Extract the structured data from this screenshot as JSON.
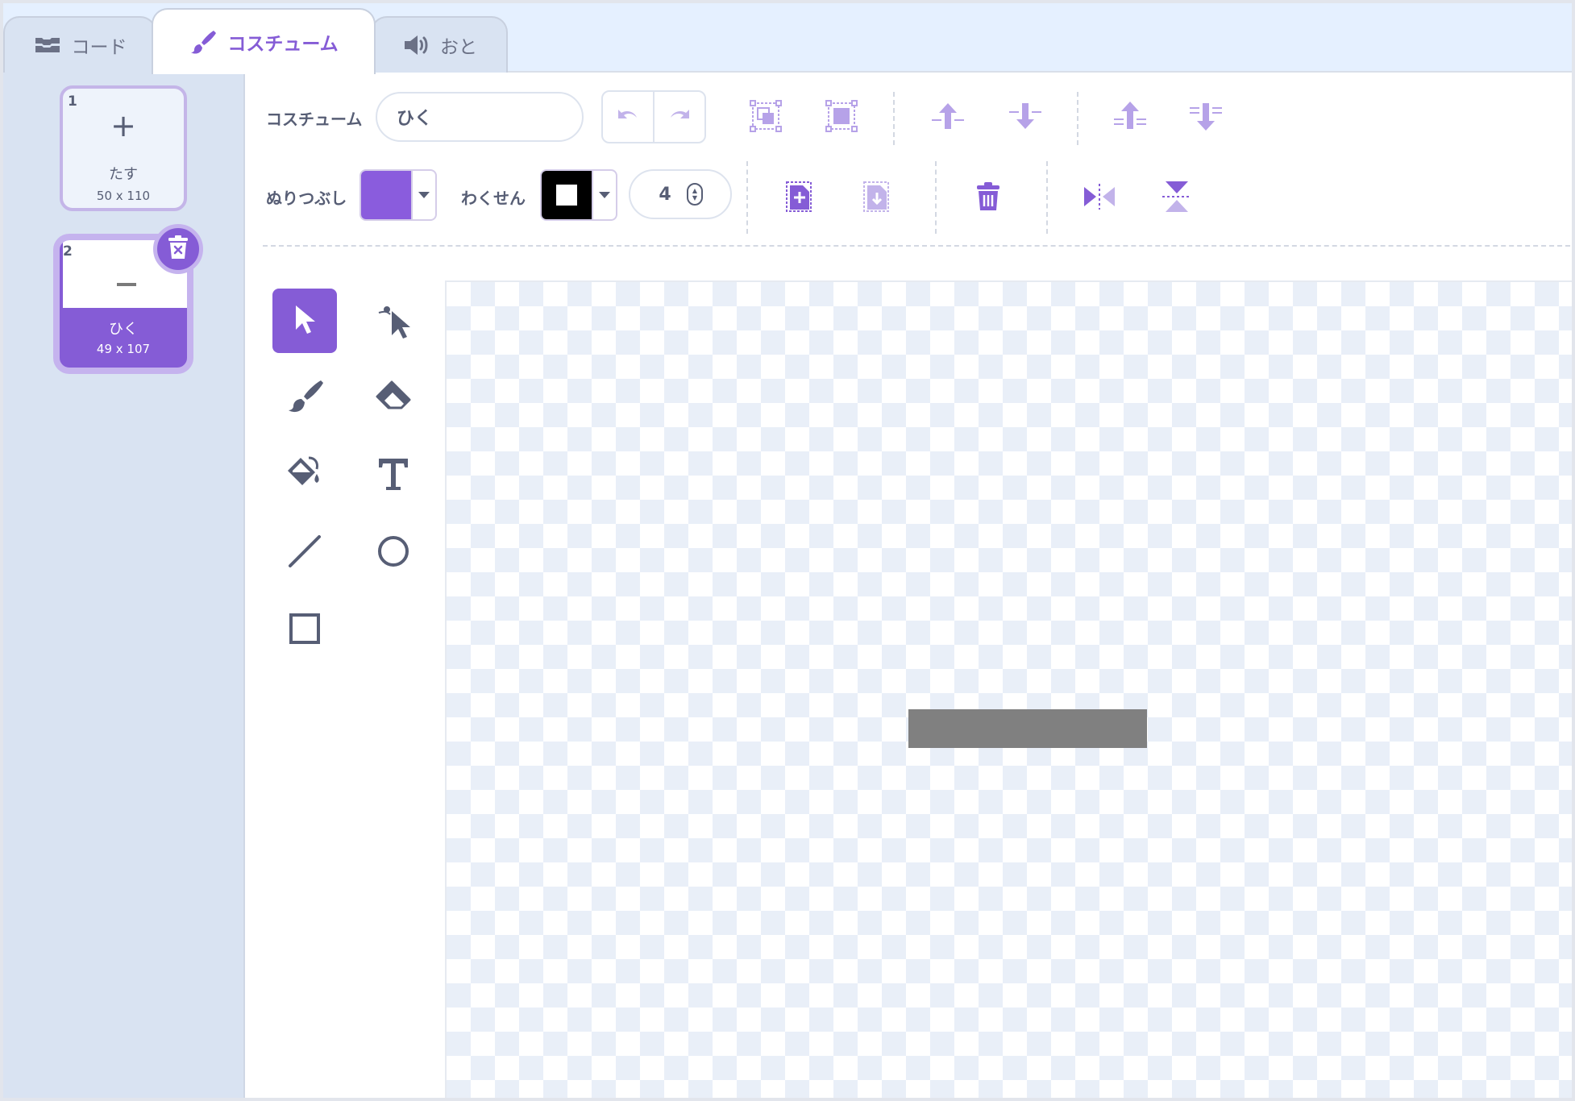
{
  "tabs": [
    {
      "label": "コード",
      "icon": "code-blocks-icon"
    },
    {
      "label": "コスチューム",
      "icon": "paintbrush-icon",
      "active": true
    },
    {
      "label": "おと",
      "icon": "speaker-icon"
    }
  ],
  "costumes": [
    {
      "number": "1",
      "name": "たす",
      "size": "50 x 110",
      "thumbnail": "plus"
    },
    {
      "number": "2",
      "name": "ひく",
      "size": "49 x 107",
      "thumbnail": "minus",
      "selected": true
    }
  ],
  "toolbar": {
    "costume_label": "コスチューム",
    "costume_name": "ひく",
    "fill_label": "ぬりつぶし",
    "outline_label": "わくせん",
    "outline_width": "4",
    "fill_color": "#8a5cdd",
    "outline_color": "#000000"
  },
  "tools": [
    "select-tool",
    "reshape-tool",
    "brush-tool",
    "eraser-tool",
    "fill-tool",
    "text-tool",
    "line-tool",
    "circle-tool",
    "rectangle-tool"
  ],
  "active_tool": "select-tool",
  "canvas": {
    "shape_color": "#808080"
  },
  "colors": {
    "accent": "#855cd6",
    "text": "#575e75",
    "icon_light": "#b6a2e8"
  }
}
